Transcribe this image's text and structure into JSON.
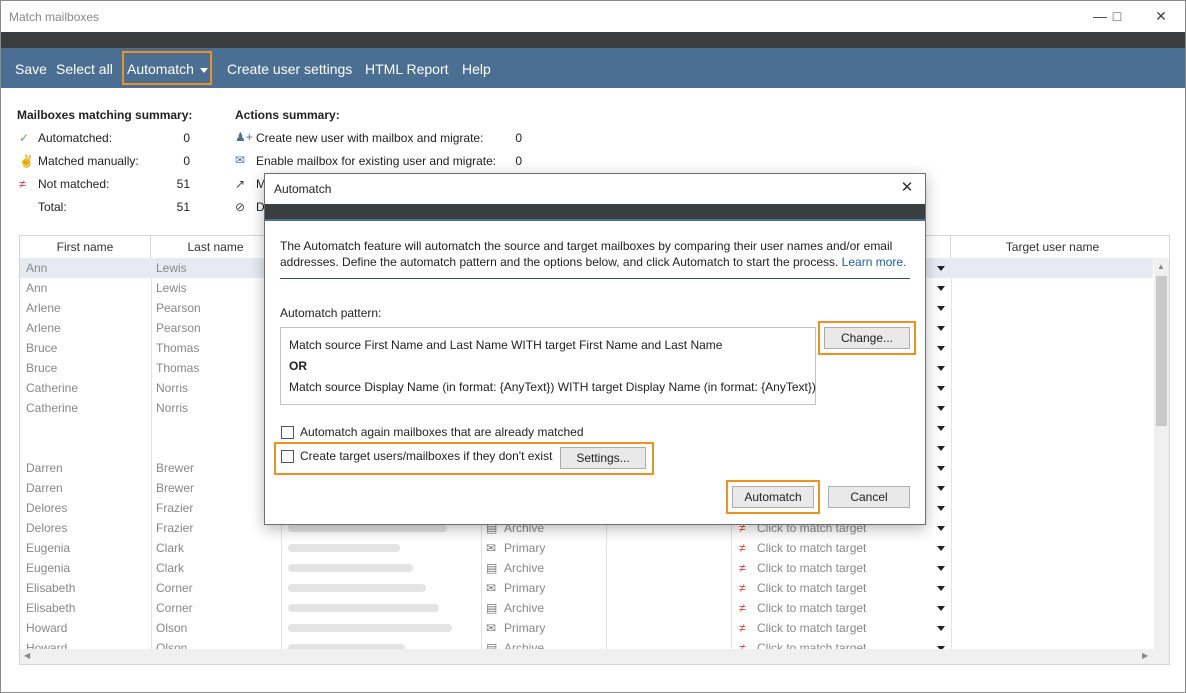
{
  "window": {
    "title": "Match mailboxes"
  },
  "toolbar": {
    "save": "Save",
    "select_all": "Select all",
    "automatch": "Automatch",
    "create_user_settings": "Create user settings",
    "html_report": "HTML Report",
    "help": "Help"
  },
  "matching_summary": {
    "heading": "Mailboxes matching summary:",
    "automatched_label": "Automatched:",
    "automatched_value": "0",
    "manual_label": "Matched manually:",
    "manual_value": "0",
    "not_matched_label": "Not matched:",
    "not_matched_value": "51",
    "total_label": "Total:",
    "total_value": "51"
  },
  "actions_summary": {
    "heading": "Actions summary:",
    "create_label": "Create new user with mailbox and migrate:",
    "create_value": "0",
    "enable_label": "Enable mailbox for existing user and migrate:",
    "enable_value": "0",
    "row3_label": "M",
    "row4_label": "D"
  },
  "grid": {
    "headers": {
      "first_name": "First name",
      "last_name": "Last name",
      "target_user_name": "Target user name"
    },
    "rows": [
      {
        "first": "Ann",
        "last": "Lewis"
      },
      {
        "first": "Ann",
        "last": "Lewis"
      },
      {
        "first": "Arlene",
        "last": "Pearson"
      },
      {
        "first": "Arlene",
        "last": "Pearson"
      },
      {
        "first": "Bruce",
        "last": "Thomas"
      },
      {
        "first": "Bruce",
        "last": "Thomas"
      },
      {
        "first": "Catherine",
        "last": "Norris"
      },
      {
        "first": "Catherine",
        "last": "Norris"
      },
      {
        "first": "",
        "last": ""
      },
      {
        "first": "",
        "last": ""
      },
      {
        "first": "Darren",
        "last": "Brewer"
      },
      {
        "first": "Darren",
        "last": "Brewer"
      },
      {
        "first": "Delores",
        "last": "Frazier"
      },
      {
        "first": "Delores",
        "last": "Frazier",
        "type": "Archive",
        "match": "Click to match target"
      },
      {
        "first": "Eugenia",
        "last": "Clark",
        "type": "Primary",
        "match": "Click to match target"
      },
      {
        "first": "Eugenia",
        "last": "Clark",
        "type": "Archive",
        "match": "Click to match target"
      },
      {
        "first": "Elisabeth",
        "last": "Corner",
        "type": "Primary",
        "match": "Click to match target"
      },
      {
        "first": "Elisabeth",
        "last": "Corner",
        "type": "Archive",
        "match": "Click to match target"
      },
      {
        "first": "Howard",
        "last": "Olson",
        "type": "Primary",
        "match": "Click to match target"
      },
      {
        "first": "Howard",
        "last": "Olson",
        "type": "Archive",
        "match": "Click to match target"
      }
    ]
  },
  "dialog": {
    "title": "Automatch",
    "description": "The Automatch feature will automatch the source and target mailboxes by comparing their user names and/or email addresses. Define the automatch pattern and the options below, and click Automatch to start the process.",
    "learn_more": "Learn more.",
    "pattern_label": "Automatch pattern:",
    "pattern_line1": "Match source First Name and Last Name WITH target First Name and Last Name",
    "pattern_or": "OR",
    "pattern_line2": "Match source Display Name (in format: {AnyText}) WITH target Display Name (in format: {AnyText})",
    "change_button": "Change...",
    "option_again": "Automatch again mailboxes that are already matched",
    "option_create": "Create target users/mailboxes if they don't exist",
    "settings_button": "Settings...",
    "automatch_button": "Automatch",
    "cancel_button": "Cancel"
  },
  "colors": {
    "toolbar": "#4b6f93",
    "highlight": "#f0901e",
    "dark_strip": "#3b3d3e"
  }
}
